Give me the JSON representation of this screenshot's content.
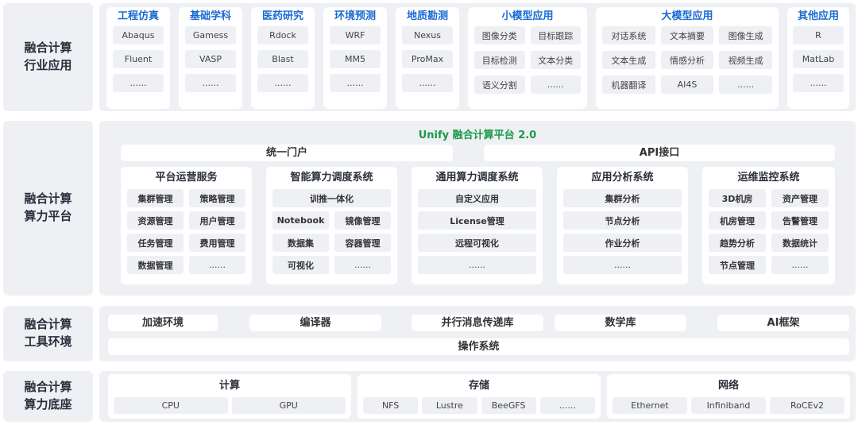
{
  "rows": {
    "industry": "融合计算\n行业应用",
    "platform": "融合计算\n算力平台",
    "tools": "融合计算\n工具环境",
    "base": "融合计算\n算力底座"
  },
  "apps": [
    {
      "title": "工程仿真",
      "items": [
        "Abaqus",
        "Fluent",
        "......"
      ]
    },
    {
      "title": "基础学科",
      "items": [
        "Gamess",
        "VASP",
        "......"
      ]
    },
    {
      "title": "医药研究",
      "items": [
        "Rdock",
        "Blast",
        "......"
      ]
    },
    {
      "title": "环境预测",
      "items": [
        "WRF",
        "MM5",
        "......"
      ]
    },
    {
      "title": "地质勘测",
      "items": [
        "Nexus",
        "ProMax",
        "......"
      ]
    },
    {
      "title": "小模型应用",
      "items": [
        "图像分类",
        "目标跟踪",
        "目标检测",
        "文本分类",
        "语义分割",
        "......"
      ]
    },
    {
      "title": "大模型应用",
      "items": [
        "对话系统",
        "文本摘要",
        "图像生成",
        "文本生成",
        "情感分析",
        "视频生成",
        "机器翻译",
        "AI4S",
        "......"
      ]
    },
    {
      "title": "其他应用",
      "items": [
        "R",
        "MatLab",
        "......"
      ]
    }
  ],
  "platform": {
    "title": "Unify 融合计算平台 2.0",
    "portal": "统一门户",
    "api": "API接口",
    "systems": [
      {
        "title": "平台运营服务",
        "items": [
          "集群管理",
          "策略管理",
          "资源管理",
          "用户管理",
          "任务管理",
          "费用管理",
          "数据管理",
          "......"
        ]
      },
      {
        "title": "智能算力调度系统",
        "top": "训推一体化",
        "items": [
          "Notebook",
          "镜像管理",
          "数据集",
          "容器管理",
          "可视化",
          "......"
        ]
      },
      {
        "title": "通用算力调度系统",
        "items": [
          "自定义应用",
          "License管理",
          "远程可视化",
          "......"
        ]
      },
      {
        "title": "应用分析系统",
        "items": [
          "集群分析",
          "节点分析",
          "作业分析",
          "......"
        ]
      },
      {
        "title": "运维监控系统",
        "items": [
          "3D机房",
          "资产管理",
          "机房管理",
          "告警管理",
          "趋势分析",
          "数据统计",
          "节点管理",
          "......"
        ]
      }
    ]
  },
  "tools": {
    "items": [
      "加速环境",
      "编译器",
      "并行消息传递库",
      "数学库",
      "AI框架"
    ],
    "os": "操作系统"
  },
  "base": [
    {
      "title": "计算",
      "items": [
        "CPU",
        "GPU"
      ]
    },
    {
      "title": "存储",
      "items": [
        "NFS",
        "Lustre",
        "BeeGFS",
        "......"
      ]
    },
    {
      "title": "网络",
      "items": [
        "Ethernet",
        "Infiniband",
        "RoCEv2"
      ]
    }
  ]
}
